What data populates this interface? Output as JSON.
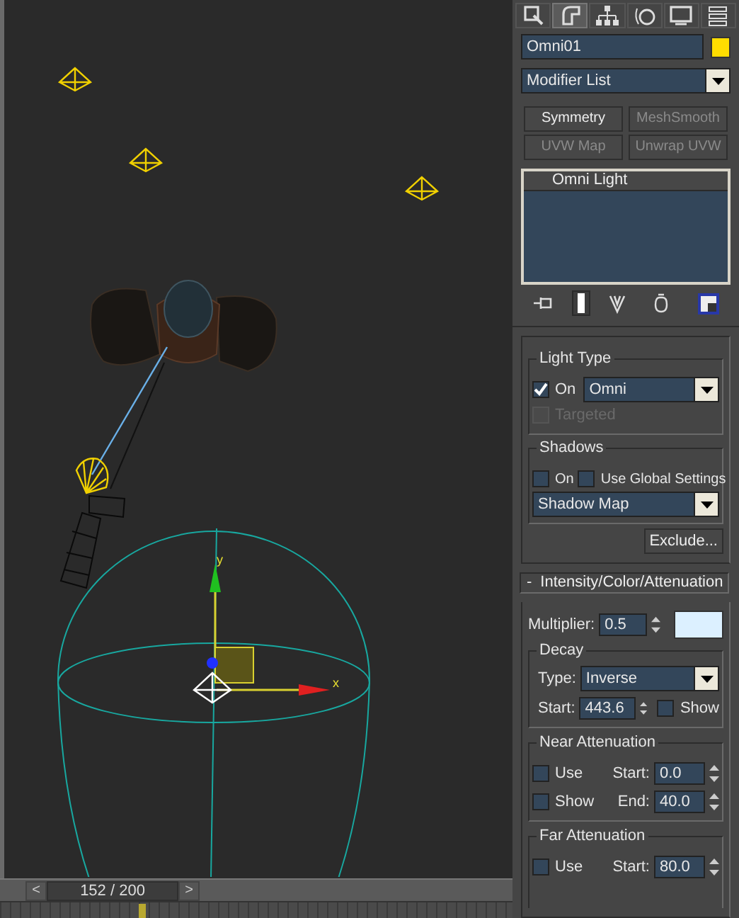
{
  "viewport": {
    "axis_labels": [
      {
        "kind": "y",
        "text": "y"
      },
      {
        "kind": "x",
        "text": "x"
      }
    ]
  },
  "timeline": {
    "prev": "<",
    "frame": "152 / 200",
    "next": ">"
  },
  "command_tabs": [
    {
      "kind": "create",
      "selected": false
    },
    {
      "kind": "modify",
      "selected": true
    },
    {
      "kind": "hierarchy",
      "selected": false
    },
    {
      "kind": "motion",
      "selected": false
    },
    {
      "kind": "display",
      "selected": false
    },
    {
      "kind": "utilities",
      "selected": false
    }
  ],
  "object": {
    "name": "Omni01",
    "color": "#ffdd00"
  },
  "modifier_list": {
    "value": "Modifier List"
  },
  "modifier_buttons": [
    {
      "label": "Symmetry",
      "disabled": false
    },
    {
      "label": "MeshSmooth",
      "disabled": true
    },
    {
      "label": "UVW Map",
      "disabled": true
    },
    {
      "label": "Unwrap UVW",
      "disabled": true
    }
  ],
  "stack": [
    {
      "label": "Omni Light",
      "selected": false
    }
  ],
  "stack_tools": [
    {
      "kind": "pin",
      "selected": false
    },
    {
      "kind": "show-end",
      "selected": true
    },
    {
      "kind": "unique",
      "selected": false
    },
    {
      "kind": "remove",
      "selected": false
    },
    {
      "kind": "configure",
      "selected": false
    }
  ],
  "light_type": {
    "title": "Light Type",
    "on": {
      "label": "On",
      "checked": true
    },
    "type": "Omni",
    "targeted": {
      "label": "Targeted",
      "checked": false,
      "disabled": true
    }
  },
  "shadows": {
    "title": "Shadows",
    "on": {
      "label": "On",
      "checked": false
    },
    "use_global": {
      "label": "Use Global Settings",
      "checked": false
    },
    "type": "Shadow Map",
    "exclude": "Exclude..."
  },
  "rollout": {
    "toggle": "-",
    "title": "Intensity/Color/Attenuation"
  },
  "multiplier": {
    "label": "Multiplier:",
    "value": "0.5",
    "color": "#dcf0ff"
  },
  "decay": {
    "title": "Decay",
    "type_label": "Type:",
    "type": "Inverse",
    "start_label": "Start:",
    "start": "443.6",
    "show": {
      "label": "Show",
      "checked": false
    }
  },
  "near_attenuation": {
    "title": "Near Attenuation",
    "use": {
      "label": "Use",
      "checked": false
    },
    "show": {
      "label": "Show",
      "checked": false
    },
    "start_label": "Start:",
    "start": "0.0",
    "end_label": "End:",
    "end": "40.0"
  },
  "far_attenuation": {
    "title": "Far Attenuation",
    "use": {
      "label": "Use",
      "checked": false
    },
    "start_label": "Start:",
    "start": "80.0"
  }
}
